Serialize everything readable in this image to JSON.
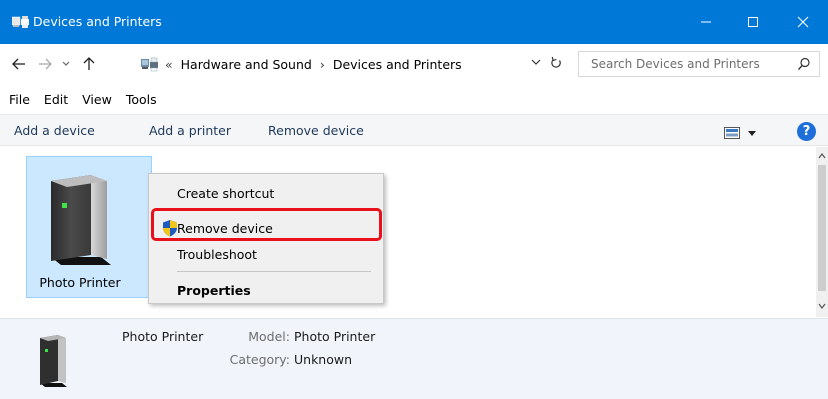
{
  "window": {
    "title": "Devices and Printers",
    "minimize_glyph": "—",
    "maximize_glyph": "☐",
    "close_glyph": "✕"
  },
  "nav": {
    "back_glyph": "←",
    "forward_glyph": "→",
    "history_glyph": "⌄",
    "up_glyph": "↑"
  },
  "address": {
    "overflow": "«",
    "crumbs": [
      "Hardware and Sound",
      "Devices and Printers"
    ],
    "separator": "›"
  },
  "search": {
    "placeholder": "Search Devices and Printers"
  },
  "menu": [
    "File",
    "Edit",
    "View",
    "Tools"
  ],
  "commands": [
    "Add a device",
    "Add a printer",
    "Remove device"
  ],
  "help_label": "?",
  "device": {
    "name": "Photo Printer"
  },
  "context_menu": {
    "items": [
      "Create shortcut",
      "Remove device",
      "Troubleshoot",
      "Properties"
    ]
  },
  "details": {
    "name": "Photo Printer",
    "model_label": "Model:",
    "model_value": "Photo Printer",
    "category_label": "Category:",
    "category_value": "Unknown"
  },
  "colors": {
    "titlebar": "#0078d7",
    "selection": "#cce8ff",
    "highlight_border": "#e8101b"
  },
  "icons": [
    "devices-printers-icon",
    "shield-icon",
    "printer-device-icon",
    "search-icon",
    "refresh-icon",
    "help-icon"
  ]
}
